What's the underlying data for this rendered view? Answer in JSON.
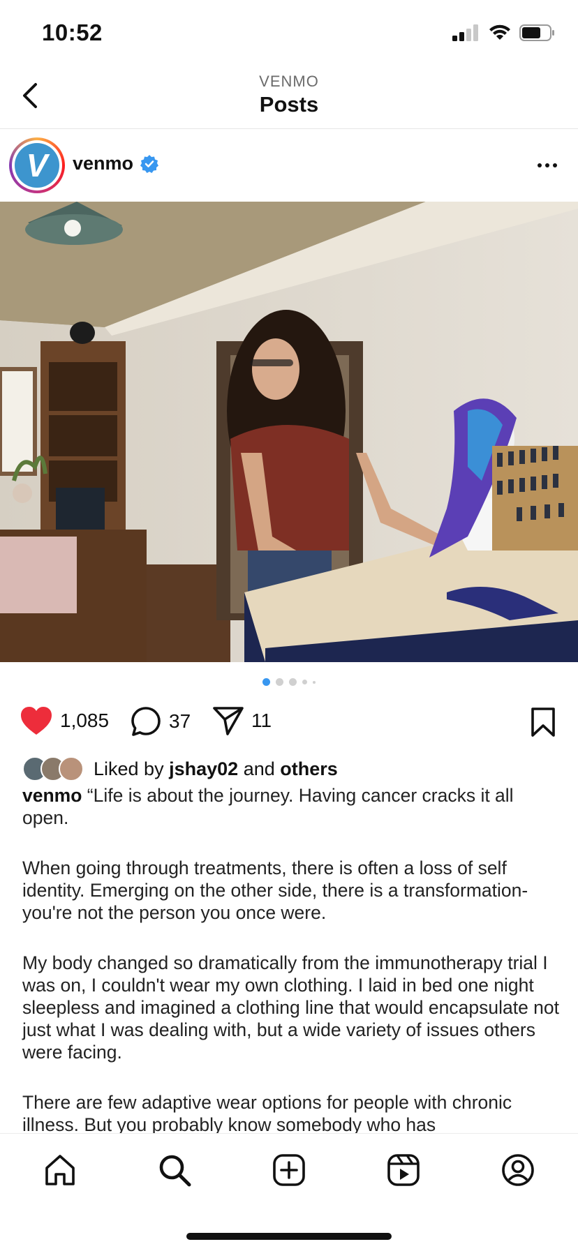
{
  "status_bar": {
    "time": "10:52"
  },
  "header": {
    "subtitle": "VENMO",
    "title": "Posts"
  },
  "post": {
    "username": "venmo",
    "avatar_letter": "V",
    "brand_color": "#3d95ce",
    "like_count": "1,085",
    "comment_count": "37",
    "share_count": "11",
    "carousel": {
      "total": 5,
      "active": 1
    },
    "liked_by_prefix": "Liked by",
    "liked_by_user": "jshay02",
    "liked_by_and": "and",
    "liked_by_others": "others",
    "caption_user": "venmo",
    "caption_paragraphs": [
      "“Life is about the journey. Having cancer cracks it all open.",
      "When going through treatments, there is often a loss of self identity. Emerging on the other side, there is a transformation- you're not the person you once were.",
      "My body changed so dramatically from the immunotherapy trial I was on, I couldn't wear my own clothing. I laid in bed one night sleepless and imagined a clothing line that would encapsulate not just what I was dealing with, but a wide variety of issues others were facing.",
      "There are few adaptive wear options for people with chronic illness. But you probably know somebody who has"
    ]
  },
  "nav": {
    "items": [
      "home-icon",
      "search-icon",
      "create-icon",
      "reels-icon",
      "profile-icon"
    ]
  },
  "colors": {
    "like": "#ed4956",
    "verified": "#3897f0",
    "active_dot": "#3897f0"
  }
}
